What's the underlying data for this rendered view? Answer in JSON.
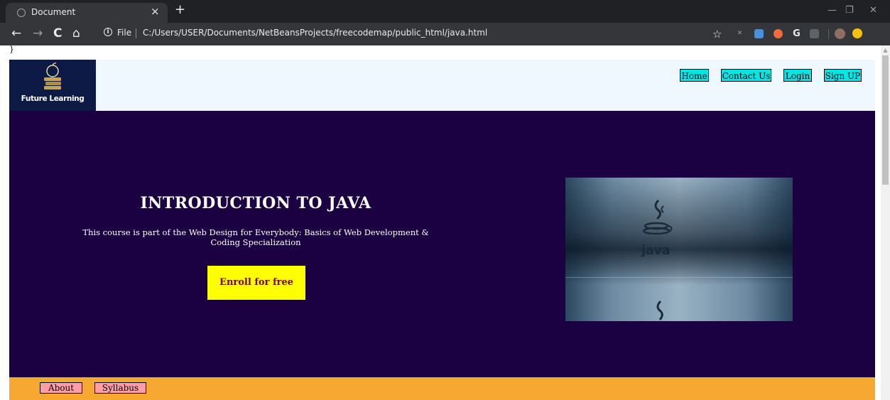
{
  "browser": {
    "tab_title": "Document",
    "tab_close": "×",
    "new_tab": "+",
    "nav": {
      "back": "←",
      "forward": "→",
      "reload": "C",
      "home": "⌂"
    },
    "address": {
      "info": "i",
      "scheme": "File",
      "url": "C:/Users/USER/Documents/NetBeansProjects/freecodemap/public_html/java.html"
    },
    "window_controls": {
      "minimize": "—",
      "restore": "❐",
      "close": "✕"
    },
    "extensions": [
      "star-icon",
      "x-extension-icon",
      "edit-extension-icon",
      "orange-extension-icon",
      "g-extension-icon",
      "grey-extension-icon",
      "profile-avatar",
      "yellow-extension-icon"
    ],
    "star": "☆",
    "ext_letter_g": "G",
    "ext_letter_x": "✕"
  },
  "page": {
    "stray_text": "}",
    "logo": {
      "text": "Future Learning"
    },
    "nav": [
      {
        "label": "Home"
      },
      {
        "label": "Contact Us"
      },
      {
        "label": "Login"
      },
      {
        "label": "Sign UP"
      }
    ],
    "hero": {
      "title": "INTRODUCTION TO JAVA",
      "subtitle": "This course is part of the Web Design for Everybody: Basics of Web Development & Coding Specialization",
      "cta": "Enroll for free",
      "image_label": "java"
    },
    "footer": [
      {
        "label": "About"
      },
      {
        "label": "Syllabus"
      }
    ]
  },
  "colors": {
    "header_bg": "#f0f8ff",
    "logo_bg": "#0d1a45",
    "nav_bg": "#00e6e6",
    "hero_bg": "#1c0142",
    "cta_bg": "#ffff00",
    "footer_bg": "#f7a833",
    "footer_link_bg": "#ff9ea6"
  }
}
